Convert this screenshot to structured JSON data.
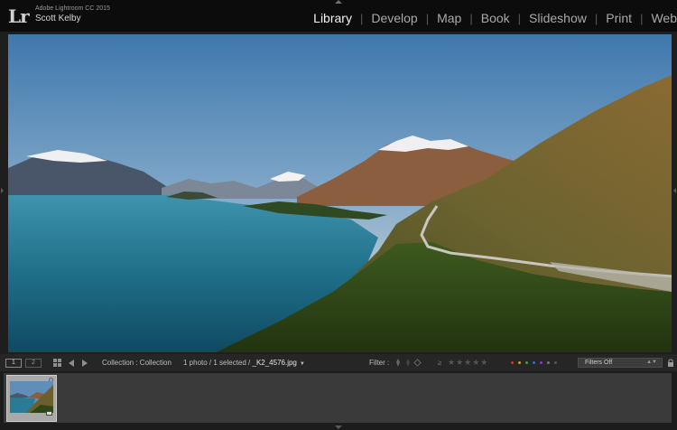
{
  "identity": {
    "logo": "Lr",
    "app_name": "Adobe Lightroom CC 2015",
    "user_name": "Scott Kelby"
  },
  "modules": [
    {
      "label": "Library",
      "active": true
    },
    {
      "label": "Develop",
      "active": false
    },
    {
      "label": "Map",
      "active": false
    },
    {
      "label": "Book",
      "active": false
    },
    {
      "label": "Slideshow",
      "active": false
    },
    {
      "label": "Print",
      "active": false
    },
    {
      "label": "Web",
      "active": false
    }
  ],
  "module_separator": "|",
  "toolbar": {
    "page_1": "1",
    "page_2": "2",
    "collection": "Collection : Collection",
    "count": "1 photo / 1 selected / ",
    "filename": "_K2_4576.jpg",
    "filter_label": "Filter :",
    "rating_op": "≥",
    "stars": "★★★★★",
    "label_colors": [
      "#c83a3a",
      "#c8a03a",
      "#3aa040",
      "#3a6ac8",
      "#8a3ac8",
      "#777777",
      "#555555"
    ],
    "filters_dropdown": "Filters Off"
  },
  "icons": {
    "grid": "grid-icon",
    "prev": "arrow-left-icon",
    "next": "arrow-right-icon",
    "lock": "lock-icon"
  },
  "colors": {
    "active_module": "#f2f2f2",
    "inactive_module": "#a9a9a9",
    "topbar": "#0c0c0c",
    "background": "#1e1e1e"
  }
}
